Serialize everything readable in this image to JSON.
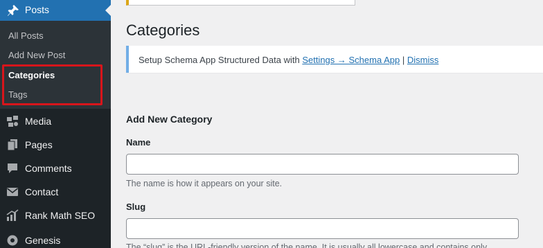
{
  "sidebar": {
    "posts_label": "Posts",
    "submenu": [
      "All Posts",
      "Add New Post",
      "Categories",
      "Tags"
    ],
    "menu": [
      {
        "label": "Media",
        "icon": "media-icon"
      },
      {
        "label": "Pages",
        "icon": "pages-icon"
      },
      {
        "label": "Comments",
        "icon": "comments-icon"
      },
      {
        "label": "Contact",
        "icon": "contact-icon"
      },
      {
        "label": "Rank Math SEO",
        "icon": "rank-math-icon"
      },
      {
        "label": "Genesis",
        "icon": "genesis-icon"
      }
    ],
    "accent_color": "#2271b1",
    "highlight_color": "#d8151b"
  },
  "main": {
    "title": "Categories",
    "notice": {
      "text": "Setup Schema App Structured Data with",
      "link": "Settings → Schema App",
      "separator": "|",
      "dismiss": "Dismiss"
    },
    "form": {
      "title": "Add New Category",
      "name_label": "Name",
      "name_value": "",
      "name_desc": "The name is how it appears on your site.",
      "slug_label": "Slug",
      "slug_value": "",
      "slug_desc": "The “slug” is the URL-friendly version of the name. It is usually all lowercase and contains only"
    }
  }
}
